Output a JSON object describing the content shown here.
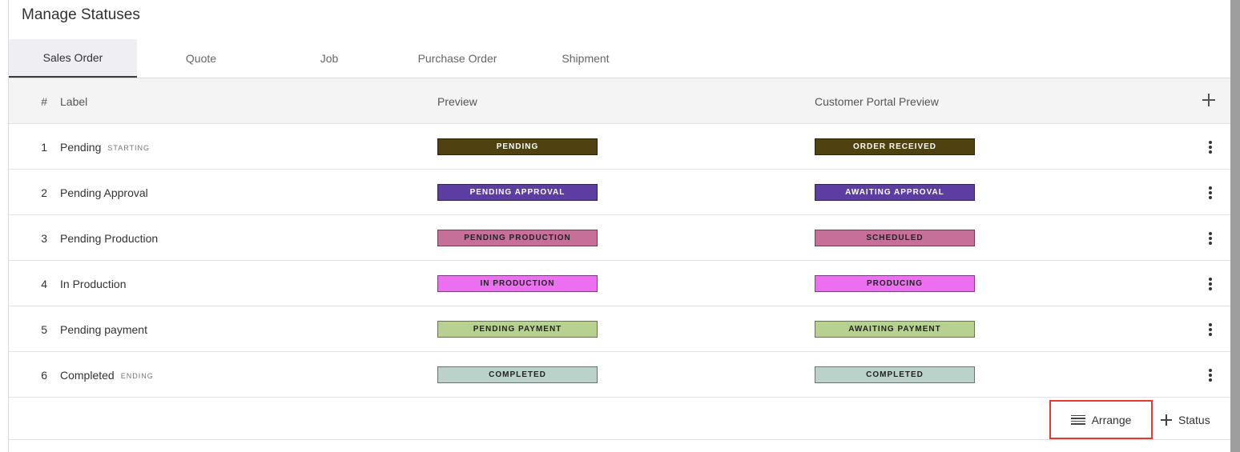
{
  "page": {
    "title": "Manage Statuses"
  },
  "tabs": [
    {
      "label": "Sales Order",
      "active": true
    },
    {
      "label": "Quote",
      "active": false
    },
    {
      "label": "Job",
      "active": false
    },
    {
      "label": "Purchase Order",
      "active": false
    },
    {
      "label": "Shipment",
      "active": false
    }
  ],
  "table": {
    "headers": {
      "num": "#",
      "label": "Label",
      "preview": "Preview",
      "portal": "Customer Portal Preview"
    },
    "rows": [
      {
        "num": "1",
        "label": "Pending",
        "tag": "STARTING",
        "preview": "PENDING",
        "portal": "ORDER RECEIVED",
        "bg": "#4f4110",
        "fg": "#ffffff"
      },
      {
        "num": "2",
        "label": "Pending Approval",
        "tag": "",
        "preview": "PENDING APPROVAL",
        "portal": "AWAITING APPROVAL",
        "bg": "#5c3ea3",
        "fg": "#ffffff"
      },
      {
        "num": "3",
        "label": "Pending Production",
        "tag": "",
        "preview": "PENDING PRODUCTION",
        "portal": "SCHEDULED",
        "bg": "#c67099",
        "fg": "#222222"
      },
      {
        "num": "4",
        "label": "In Production",
        "tag": "",
        "preview": "IN PRODUCTION",
        "portal": "PRODUCING",
        "bg": "#eb6ff0",
        "fg": "#222222"
      },
      {
        "num": "5",
        "label": "Pending payment",
        "tag": "",
        "preview": "PENDING PAYMENT",
        "portal": "AWAITING PAYMENT",
        "bg": "#b8d191",
        "fg": "#222222"
      },
      {
        "num": "6",
        "label": "Completed",
        "tag": "ENDING",
        "preview": "COMPLETED",
        "portal": "COMPLETED",
        "bg": "#bad2ca",
        "fg": "#222222"
      }
    ]
  },
  "footer": {
    "arrange_label": "Arrange",
    "status_label": "Status"
  }
}
